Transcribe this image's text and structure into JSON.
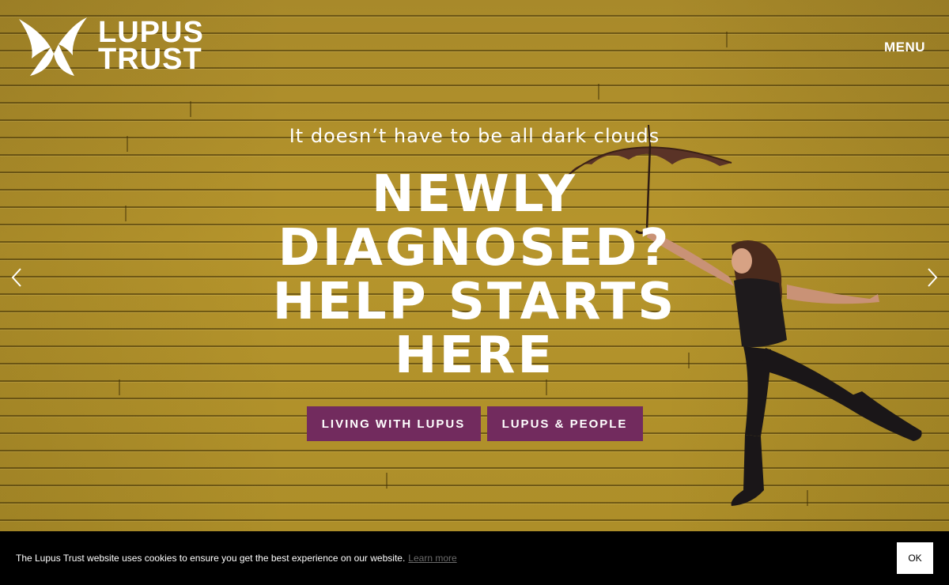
{
  "brand": {
    "logo_line1": "LUPUS",
    "logo_line2": "TRUST",
    "logo_icon": "butterfly-icon"
  },
  "header": {
    "menu_label": "MENU"
  },
  "hero": {
    "tagline": "It doesn’t have to be all dark clouds",
    "headline": "NEWLY DIAGNOSED? HELP STARTS HERE",
    "prev_icon": "chevron-left-icon",
    "next_icon": "chevron-right-icon",
    "buttons": [
      {
        "label": "LIVING WITH LUPUS"
      },
      {
        "label": "LUPUS & PEOPLE"
      }
    ]
  },
  "cookie": {
    "message": "The Lupus Trust website uses cookies to ensure you get the best experience on our website.",
    "learn_more": "Learn more",
    "ok_label": "OK"
  },
  "colors": {
    "accent": "#722b5e",
    "background": "#b09027",
    "cookie_bar": "#000000"
  }
}
